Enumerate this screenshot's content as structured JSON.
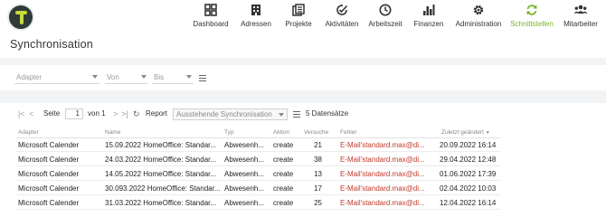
{
  "nav": [
    {
      "label": "Dashboard",
      "icon": "dashboard-icon"
    },
    {
      "label": "Adressen",
      "icon": "building-icon"
    },
    {
      "label": "Projekte",
      "icon": "projects-icon"
    },
    {
      "label": "Aktivitäten",
      "icon": "activities-icon"
    },
    {
      "label": "Arbeitszeit",
      "icon": "clock-icon"
    },
    {
      "label": "Finanzen",
      "icon": "bar-chart-icon"
    },
    {
      "label": "Administration",
      "icon": "gear-icon"
    },
    {
      "label": "Schnittstellen",
      "icon": "sync-icon",
      "active": true
    },
    {
      "label": "Mitarbeiter",
      "icon": "users-icon"
    }
  ],
  "page": {
    "title": "Synchronisation"
  },
  "filters": {
    "adapter_placeholder": "Adapter",
    "von_placeholder": "Von",
    "bis_placeholder": "Bis"
  },
  "pager": {
    "page_label": "Seite",
    "page_value": "1",
    "of_label": "von 1",
    "report_label": "Report",
    "report_value": "Ausstehende Synchronisation",
    "count": "5 Datensätze"
  },
  "table": {
    "headers": [
      "Adapter",
      "Name",
      "Typ",
      "Aktion",
      "Versuche",
      "Fehler",
      "Zuletzt geändert"
    ],
    "sort_indicator": "▼",
    "rows": [
      [
        "Microsoft Calender",
        "15.09.2022 HomeOffice: Standar...",
        "Abwesenh...",
        "create",
        "21",
        "E-Mail'standard.max@di...",
        "20.09.2022 16:14"
      ],
      [
        "Microsoft Calender",
        "24.03.2022 HomeOffice: Standar...",
        "Abwesenh...",
        "create",
        "38",
        "E-Mail'standard.max@di...",
        "29.04.2022 12:48"
      ],
      [
        "Microsoft Calender",
        "14.05.2022 HomeOffice: Standar...",
        "Abwesenh...",
        "create",
        "13",
        "E-Mail'standard.max@di...",
        "01.06.2022 17:39"
      ],
      [
        "Microsoft Calender",
        "30.093.2022 HomeOffice: Standar...",
        "Abwesenh...",
        "create",
        "17",
        "E-Mail'standard.max@di...",
        "02.04.2022 10:03"
      ],
      [
        "Microsoft Calender",
        "31.03.2022 HomeOffice: Standar...",
        "Abwesenh...",
        "create",
        "25",
        "E-Mail'standard.max@di...",
        "12.04.2022 16:14"
      ]
    ]
  },
  "colors": {
    "accent": "#7bb32e",
    "error": "#c0392b",
    "logo_bg": "#2f3b39",
    "logo_t": "#c7dc3a"
  }
}
